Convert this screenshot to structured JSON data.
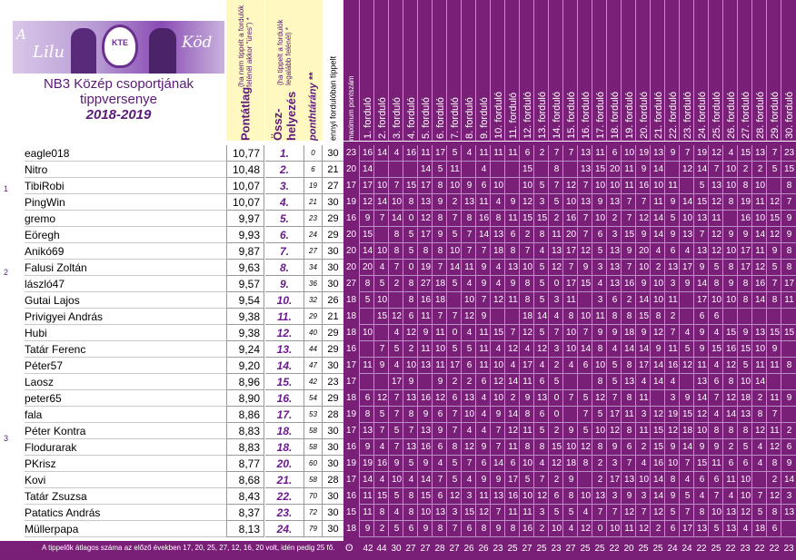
{
  "banner": {
    "a": "A",
    "lilu": "Lilu",
    "kod": "Köd",
    "crest": "KTE"
  },
  "title": {
    "line1": "NB3 Közép csoportjának",
    "line2": "tippversenye",
    "season": "2018-2019"
  },
  "headers": {
    "pontatlag": "Pontátlag",
    "pontatlag_note": "(ha nem tippelt a fordulók felénél akkor \"üres\") *",
    "ossz": "Össz-helyezés",
    "ossz_note": "(ha tippelt a fordulók legalább felénél) *",
    "pontarany": "ponthtárány  **",
    "min_tipp": "ennyi forduló­ban tippelt",
    "max_pont": "maximum pontszám"
  },
  "rounds": [
    "1. forduló",
    "2. forduló",
    "3. forduló",
    "4. forduló",
    "5. forduló",
    "6. forduló",
    "7. forduló",
    "8. forduló",
    "9. forduló",
    "10. forduló",
    "11. forduló",
    "12. forduló",
    "13. forduló",
    "14. forduló",
    "15. forduló",
    "16. forduló",
    "17. forduló",
    "18. forduló",
    "19. forduló",
    "20. forduló",
    "21. forduló",
    "22. forduló",
    "23. forduló",
    "24. forduló",
    "25. forduló",
    "26. forduló",
    "27. forduló",
    "28. forduló",
    "29. forduló",
    "30. forduló"
  ],
  "markers": [
    "1",
    "2",
    "3"
  ],
  "players": [
    {
      "name": "eagle018",
      "pts": "10,77",
      "pos": "1.",
      "arany": "0",
      "rounds": "30",
      "max": "23",
      "scores": [
        "16",
        "14",
        "4",
        "16",
        "11",
        "17",
        "5",
        "4",
        "11",
        "11",
        "11",
        "6",
        "2",
        "7",
        "7",
        "13",
        "11",
        "6",
        "10",
        "19",
        "13",
        "9",
        "7",
        "19",
        "12",
        "4",
        "15",
        "13",
        "7",
        "23"
      ]
    },
    {
      "name": "Nitro",
      "pts": "10,48",
      "pos": "2.",
      "arany": "6",
      "rounds": "21",
      "max": "20",
      "scores": [
        "14",
        "",
        "",
        "",
        "14",
        "5",
        "11",
        "",
        "4",
        "",
        "",
        "15",
        "",
        "8",
        "",
        "13",
        "15",
        "20",
        "11",
        "9",
        "14",
        "",
        "12",
        "14",
        "7",
        "10",
        "2",
        "2",
        "5",
        "15"
      ]
    },
    {
      "name": "TibiRobi",
      "pts": "10,07",
      "pos": "3.",
      "arany": "19",
      "rounds": "27",
      "max": "17",
      "scores": [
        "17",
        "10",
        "7",
        "15",
        "17",
        "8",
        "10",
        "9",
        "6",
        "10",
        "",
        "10",
        "5",
        "7",
        "12",
        "7",
        "10",
        "10",
        "11",
        "16",
        "10",
        "11",
        "",
        "5",
        "13",
        "10",
        "8",
        "10",
        "",
        "8"
      ]
    },
    {
      "name": "PingWin",
      "pts": "10,07",
      "pos": "4.",
      "arany": "21",
      "rounds": "30",
      "max": "19",
      "scores": [
        "12",
        "14",
        "10",
        "8",
        "13",
        "9",
        "2",
        "13",
        "11",
        "4",
        "9",
        "12",
        "3",
        "5",
        "10",
        "13",
        "9",
        "13",
        "7",
        "7",
        "11",
        "9",
        "14",
        "15",
        "12",
        "8",
        "19",
        "11",
        "12",
        "7"
      ]
    },
    {
      "name": "gremo",
      "pts": "9,97",
      "pos": "5.",
      "arany": "23",
      "rounds": "29",
      "max": "16",
      "scores": [
        "9",
        "7",
        "14",
        "0",
        "12",
        "8",
        "7",
        "8",
        "16",
        "8",
        "11",
        "15",
        "15",
        "2",
        "16",
        "7",
        "10",
        "2",
        "7",
        "12",
        "14",
        "5",
        "10",
        "13",
        "11",
        "",
        "16",
        "10",
        "15",
        "9"
      ]
    },
    {
      "name": "Eöregh",
      "pts": "9,93",
      "pos": "6.",
      "arany": "24",
      "rounds": "29",
      "max": "20",
      "scores": [
        "15",
        "",
        "8",
        "5",
        "17",
        "9",
        "5",
        "7",
        "14",
        "13",
        "6",
        "2",
        "8",
        "11",
        "20",
        "7",
        "6",
        "3",
        "15",
        "9",
        "14",
        "9",
        "13",
        "7",
        "12",
        "9",
        "9",
        "14",
        "12",
        "9"
      ]
    },
    {
      "name": "Anikó69",
      "pts": "9,87",
      "pos": "7.",
      "arany": "27",
      "rounds": "30",
      "max": "20",
      "scores": [
        "14",
        "10",
        "8",
        "5",
        "8",
        "8",
        "10",
        "7",
        "7",
        "18",
        "8",
        "7",
        "4",
        "13",
        "17",
        "12",
        "5",
        "13",
        "9",
        "20",
        "4",
        "6",
        "4",
        "13",
        "12",
        "10",
        "17",
        "11",
        "9",
        "8"
      ]
    },
    {
      "name": "Falusi Zoltán",
      "pts": "9,63",
      "pos": "8.",
      "arany": "34",
      "rounds": "30",
      "max": "20",
      "scores": [
        "20",
        "4",
        "7",
        "0",
        "19",
        "7",
        "14",
        "11",
        "9",
        "4",
        "13",
        "10",
        "5",
        "12",
        "7",
        "9",
        "3",
        "13",
        "7",
        "10",
        "2",
        "13",
        "17",
        "9",
        "5",
        "8",
        "17",
        "12",
        "5",
        "8"
      ]
    },
    {
      "name": "lászló47",
      "pts": "9,57",
      "pos": "9.",
      "arany": "36",
      "rounds": "30",
      "max": "27",
      "scores": [
        "8",
        "5",
        "2",
        "8",
        "27",
        "18",
        "5",
        "4",
        "9",
        "4",
        "9",
        "8",
        "5",
        "0",
        "17",
        "15",
        "4",
        "13",
        "16",
        "9",
        "10",
        "3",
        "9",
        "14",
        "8",
        "9",
        "8",
        "16",
        "7",
        "17"
      ]
    },
    {
      "name": "Gutai Lajos",
      "pts": "9,54",
      "pos": "10.",
      "arany": "32",
      "rounds": "26",
      "max": "18",
      "scores": [
        "5",
        "10",
        "",
        "8",
        "16",
        "18",
        "",
        "10",
        "7",
        "12",
        "11",
        "8",
        "5",
        "3",
        "11",
        "",
        "3",
        "6",
        "2",
        "14",
        "10",
        "11",
        "",
        "17",
        "10",
        "10",
        "8",
        "14",
        "8",
        "11"
      ]
    },
    {
      "name": "Privigyei András",
      "pts": "9,38",
      "pos": "11.",
      "arany": "29",
      "rounds": "21",
      "max": "18",
      "scores": [
        "",
        "15",
        "12",
        "6",
        "11",
        "7",
        "7",
        "12",
        "9",
        "",
        "",
        "18",
        "14",
        "4",
        "8",
        "10",
        "11",
        "8",
        "8",
        "15",
        "8",
        "2",
        "",
        "6",
        "6",
        "",
        "",
        "",
        "",
        ""
      ]
    },
    {
      "name": "Hubi",
      "pts": "9,38",
      "pos": "12.",
      "arany": "40",
      "rounds": "29",
      "max": "18",
      "scores": [
        "10",
        "",
        "4",
        "12",
        "9",
        "11",
        "0",
        "4",
        "11",
        "15",
        "7",
        "12",
        "5",
        "7",
        "10",
        "7",
        "9",
        "9",
        "18",
        "9",
        "12",
        "7",
        "4",
        "9",
        "4",
        "15",
        "9",
        "13",
        "15",
        "15"
      ]
    },
    {
      "name": "Tatár Ferenc",
      "pts": "9,24",
      "pos": "13.",
      "arany": "44",
      "rounds": "29",
      "max": "16",
      "scores": [
        "",
        "7",
        "5",
        "2",
        "11",
        "10",
        "5",
        "5",
        "11",
        "4",
        "12",
        "4",
        "12",
        "3",
        "10",
        "14",
        "8",
        "4",
        "14",
        "14",
        "9",
        "11",
        "5",
        "9",
        "15",
        "16",
        "15",
        "10",
        "9",
        ""
      ]
    },
    {
      "name": "Péter57",
      "pts": "9,20",
      "pos": "14.",
      "arany": "47",
      "rounds": "30",
      "max": "17",
      "scores": [
        "11",
        "9",
        "4",
        "10",
        "13",
        "11",
        "17",
        "6",
        "11",
        "10",
        "4",
        "17",
        "4",
        "2",
        "4",
        "6",
        "10",
        "5",
        "8",
        "17",
        "14",
        "16",
        "12",
        "11",
        "4",
        "12",
        "5",
        "11",
        "11",
        "8"
      ]
    },
    {
      "name": "Laosz",
      "pts": "8,96",
      "pos": "15.",
      "arany": "42",
      "rounds": "23",
      "max": "17",
      "scores": [
        "",
        "",
        "17",
        "9",
        "",
        "9",
        "2",
        "2",
        "6",
        "12",
        "14",
        "11",
        "6",
        "5",
        "",
        "",
        "8",
        "5",
        "13",
        "4",
        "14",
        "4",
        "",
        "13",
        "6",
        "8",
        "10",
        "14",
        "",
        ""
      ]
    },
    {
      "name": "peter65",
      "pts": "8,90",
      "pos": "16.",
      "arany": "54",
      "rounds": "29",
      "max": "18",
      "scores": [
        "6",
        "12",
        "7",
        "13",
        "16",
        "12",
        "6",
        "13",
        "4",
        "10",
        "2",
        "9",
        "13",
        "0",
        "7",
        "5",
        "12",
        "7",
        "8",
        "11",
        "",
        "3",
        "9",
        "14",
        "7",
        "12",
        "18",
        "2",
        "11",
        "9"
      ]
    },
    {
      "name": "fala",
      "pts": "8,86",
      "pos": "17.",
      "arany": "53",
      "rounds": "28",
      "max": "19",
      "scores": [
        "8",
        "5",
        "7",
        "8",
        "9",
        "6",
        "7",
        "10",
        "4",
        "9",
        "14",
        "8",
        "6",
        "0",
        "",
        "7",
        "5",
        "17",
        "11",
        "3",
        "12",
        "19",
        "15",
        "12",
        "4",
        "14",
        "13",
        "8",
        "7",
        ""
      ]
    },
    {
      "name": "Péter Kontra",
      "pts": "8,83",
      "pos": "18.",
      "arany": "58",
      "rounds": "30",
      "max": "17",
      "scores": [
        "13",
        "7",
        "5",
        "7",
        "13",
        "9",
        "7",
        "4",
        "4",
        "7",
        "12",
        "11",
        "5",
        "2",
        "9",
        "5",
        "10",
        "12",
        "8",
        "11",
        "15",
        "12",
        "18",
        "10",
        "8",
        "8",
        "8",
        "12",
        "11",
        "2"
      ]
    },
    {
      "name": "Flodurarak",
      "pts": "8,83",
      "pos": "18.",
      "arany": "58",
      "rounds": "30",
      "max": "16",
      "scores": [
        "9",
        "4",
        "7",
        "13",
        "16",
        "6",
        "8",
        "12",
        "9",
        "7",
        "11",
        "8",
        "8",
        "15",
        "10",
        "12",
        "8",
        "9",
        "6",
        "2",
        "15",
        "9",
        "14",
        "9",
        "9",
        "2",
        "5",
        "4",
        "12",
        "6"
      ]
    },
    {
      "name": "PKrisz",
      "pts": "8,77",
      "pos": "20.",
      "arany": "60",
      "rounds": "30",
      "max": "19",
      "scores": [
        "19",
        "16",
        "9",
        "5",
        "9",
        "4",
        "5",
        "7",
        "6",
        "14",
        "6",
        "10",
        "4",
        "12",
        "18",
        "8",
        "2",
        "3",
        "7",
        "4",
        "16",
        "10",
        "7",
        "15",
        "11",
        "6",
        "6",
        "4",
        "8",
        "9"
      ]
    },
    {
      "name": "Kovi",
      "pts": "8,68",
      "pos": "21.",
      "arany": "58",
      "rounds": "28",
      "max": "17",
      "scores": [
        "14",
        "4",
        "10",
        "4",
        "14",
        "7",
        "5",
        "4",
        "9",
        "9",
        "17",
        "5",
        "7",
        "2",
        "9",
        "",
        "2",
        "17",
        "13",
        "10",
        "14",
        "8",
        "4",
        "6",
        "6",
        "11",
        "10",
        "",
        "2",
        "14"
      ]
    },
    {
      "name": "Tatár Zsuzsa",
      "pts": "8,43",
      "pos": "22.",
      "arany": "70",
      "rounds": "30",
      "max": "16",
      "scores": [
        "11",
        "15",
        "5",
        "8",
        "15",
        "6",
        "12",
        "3",
        "11",
        "13",
        "16",
        "10",
        "12",
        "6",
        "8",
        "10",
        "13",
        "3",
        "9",
        "3",
        "14",
        "9",
        "5",
        "4",
        "7",
        "4",
        "10",
        "7",
        "12",
        "3"
      ]
    },
    {
      "name": "Patatics András",
      "pts": "8,37",
      "pos": "23.",
      "arany": "72",
      "rounds": "30",
      "max": "15",
      "scores": [
        "11",
        "8",
        "4",
        "8",
        "10",
        "13",
        "3",
        "15",
        "12",
        "7",
        "11",
        "11",
        "3",
        "5",
        "5",
        "4",
        "7",
        "7",
        "12",
        "7",
        "12",
        "5",
        "7",
        "8",
        "10",
        "13",
        "12",
        "5",
        "8",
        "13"
      ]
    },
    {
      "name": "Müllerpapa",
      "pts": "8,13",
      "pos": "24.",
      "arany": "79",
      "rounds": "30",
      "max": "18",
      "scores": [
        "9",
        "2",
        "5",
        "6",
        "9",
        "8",
        "7",
        "6",
        "8",
        "9",
        "8",
        "16",
        "2",
        "10",
        "4",
        "12",
        "0",
        "10",
        "11",
        "12",
        "2",
        "6",
        "17",
        "13",
        "5",
        "13",
        "4",
        "18",
        "6",
        ""
      ]
    }
  ],
  "footer": {
    "note": "A tippelők átlagos száma az előző években 17, 20, 25, 27, 12, 16, 20 volt,  idén pedig   25  fő.",
    "icon": "ʘ",
    "max_label": "42",
    "averages": [
      "44",
      "30",
      "27",
      "27",
      "28",
      "27",
      "26",
      "26",
      "23",
      "25",
      "27",
      "25",
      "23",
      "27",
      "25",
      "25",
      "22",
      "20",
      "25",
      "25",
      "24",
      "24",
      "22",
      "25",
      "22",
      "23",
      "22",
      "22",
      "23",
      "22"
    ]
  }
}
